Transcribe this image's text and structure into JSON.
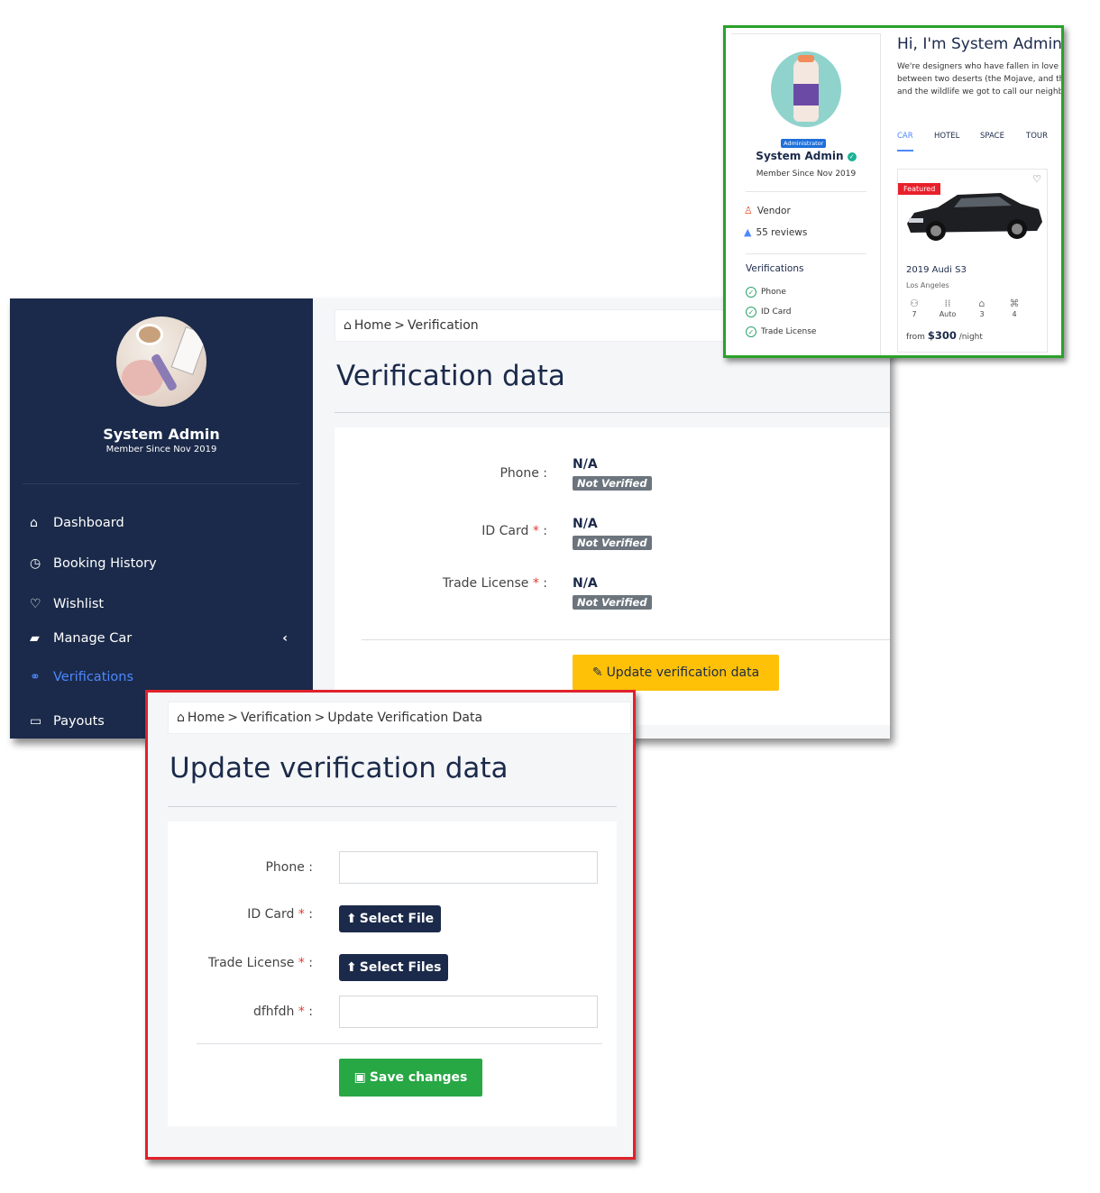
{
  "main": {
    "sidebar": {
      "user_name": "System Admin",
      "member_since": "Member Since Nov 2019",
      "menu": [
        {
          "label": "Dashboard",
          "icon": "home-icon"
        },
        {
          "label": "Booking History",
          "icon": "clock-icon"
        },
        {
          "label": "Wishlist",
          "icon": "heart-icon"
        },
        {
          "label": "Manage Car",
          "icon": "car-icon"
        },
        {
          "label": "Verifications",
          "icon": "handshake-icon",
          "active": true
        },
        {
          "label": "Payouts",
          "icon": "credit-card-icon"
        }
      ]
    },
    "breadcrumb": {
      "home": "Home",
      "separator": ">",
      "current": "Verification"
    },
    "title": "Verification data",
    "fields": [
      {
        "label": "Phone",
        "required": false,
        "value": "N/A",
        "status": "Not Verified"
      },
      {
        "label": "ID Card",
        "required": true,
        "value": "N/A",
        "status": "Not Verified"
      },
      {
        "label": "Trade License",
        "required": true,
        "value": "N/A",
        "status": "Not Verified"
      }
    ],
    "update_button": "Update verification data",
    "required_mark": "*",
    "label_suffix": ":"
  },
  "profile": {
    "badge": "Administrator",
    "name": "System Admin",
    "member_since": "Member Since Nov 2019",
    "vendor_label": "Vendor",
    "reviews": "55 reviews",
    "verifications_title": "Verifications",
    "verifications": [
      "Phone",
      "ID Card",
      "Trade License"
    ],
    "greeting": "Hi, I'm System Admin",
    "description_lines": [
      "We're designers who have fallen in love",
      "between two deserts (the Mojave, and th",
      "and the wildlife we got to call our neighb"
    ],
    "tabs": [
      "CAR",
      "HOTEL",
      "SPACE",
      "TOUR"
    ],
    "active_tab": "CAR",
    "car": {
      "featured": "Featured",
      "title": "2019 Audi S3",
      "location": "Los Angeles",
      "specs": [
        "7",
        "Auto",
        "3",
        "4"
      ],
      "price_prefix": "from",
      "price": "$300",
      "price_suffix": "/night"
    }
  },
  "update": {
    "breadcrumb": {
      "home": "Home",
      "separator": ">",
      "mid": "Verification",
      "current": "Update Verification Data"
    },
    "title": "Update verification data",
    "fields": [
      {
        "label": "Phone",
        "required": false,
        "type": "text",
        "value": ""
      },
      {
        "label": "ID Card",
        "required": true,
        "type": "file",
        "button": "Select File"
      },
      {
        "label": "Trade License",
        "required": true,
        "type": "file",
        "button": "Select Files"
      },
      {
        "label": "dfhfdh",
        "required": true,
        "type": "text",
        "value": ""
      }
    ],
    "save_button": "Save changes"
  },
  "colors": {
    "sidebar_bg": "#1b2a4a",
    "active_menu": "#4d88ff",
    "update_button": "#ffc107",
    "save_button": "#28a745",
    "badge_bg": "#6c757d",
    "profile_frame": "#2aa12a",
    "update_frame": "#e0212b"
  }
}
